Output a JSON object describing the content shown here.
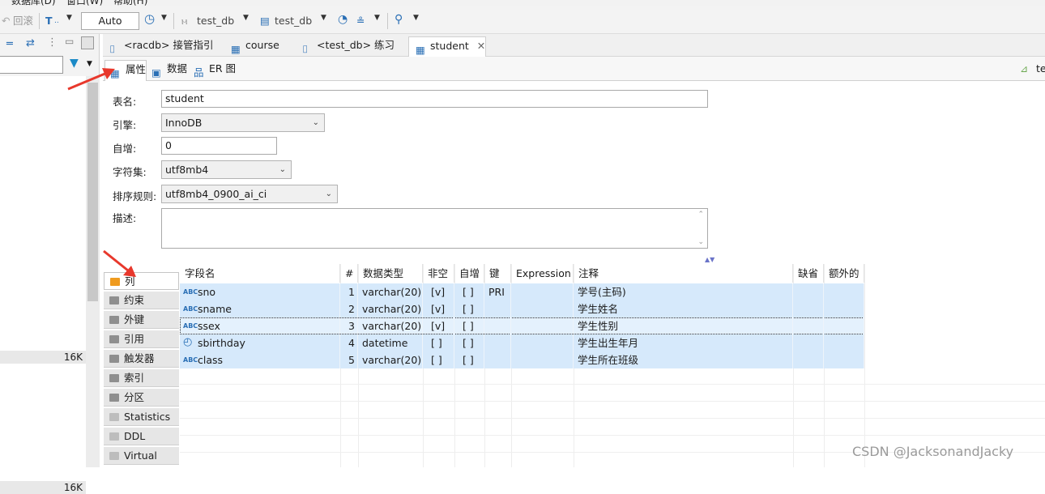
{
  "menu": {
    "database": "数据库(D)",
    "window": "窗口(W)",
    "help": "帮助(H)"
  },
  "toolbar": {
    "rollback": "回滚",
    "auto": "Auto",
    "db1": "test_db",
    "db2": "test_db"
  },
  "left": {
    "sizes": [
      "16K",
      "16K"
    ]
  },
  "tabs": [
    {
      "label": "<racdb> 接管指引"
    },
    {
      "label": "course"
    },
    {
      "label": "<test_db> 练习"
    },
    {
      "label": "student"
    }
  ],
  "subtabs": [
    "属性",
    "数据",
    "ER 图"
  ],
  "right_hint": "te",
  "form": {
    "table_name_label": "表名:",
    "table_name": "student",
    "engine_label": "引擎:",
    "engine": "InnoDB",
    "auto_inc_label": "自增:",
    "auto_inc": "0",
    "charset_label": "字符集:",
    "charset": "utf8mb4",
    "collation_label": "排序规则:",
    "collation": "utf8mb4_0900_ai_ci",
    "desc_label": "描述:"
  },
  "sections": [
    "列",
    "约束",
    "外键",
    "引用",
    "触发器",
    "索引",
    "分区",
    "Statistics",
    "DDL",
    "Virtual"
  ],
  "columns": {
    "headers": [
      "字段名",
      "#",
      "数据类型",
      "非空",
      "自增",
      "键",
      "Expression",
      "注释",
      "缺省",
      "额外的"
    ],
    "rows": [
      {
        "name": "sno",
        "num": "1",
        "type": "varchar(20)",
        "notnull": "[v]",
        "autoinc": "[ ]",
        "key": "PRI",
        "expr": "",
        "comment": "学号(主码)",
        "default": "",
        "extra": "",
        "icon": "key-text-icon"
      },
      {
        "name": "sname",
        "num": "2",
        "type": "varchar(20)",
        "notnull": "[v]",
        "autoinc": "[ ]",
        "key": "",
        "expr": "",
        "comment": "学生姓名",
        "default": "",
        "extra": "",
        "icon": "text-icon"
      },
      {
        "name": "ssex",
        "num": "3",
        "type": "varchar(20)",
        "notnull": "[v]",
        "autoinc": "[ ]",
        "key": "",
        "expr": "",
        "comment": "学生性别",
        "default": "",
        "extra": "",
        "icon": "text-icon"
      },
      {
        "name": "sbirthday",
        "num": "4",
        "type": "datetime",
        "notnull": "[ ]",
        "autoinc": "[ ]",
        "key": "",
        "expr": "",
        "comment": "学生出生年月",
        "default": "",
        "extra": "",
        "icon": "clock-icon"
      },
      {
        "name": "class",
        "num": "5",
        "type": "varchar(20)",
        "notnull": "[ ]",
        "autoinc": "[ ]",
        "key": "",
        "expr": "",
        "comment": "学生所在班级",
        "default": "",
        "extra": "",
        "icon": "text-icon"
      }
    ]
  },
  "watermark": "CSDN @JacksonandJacky",
  "colors": {
    "row_highlight": "#d6e9fb",
    "arrow": "#e8382c",
    "accent": "#1b6fc2"
  }
}
